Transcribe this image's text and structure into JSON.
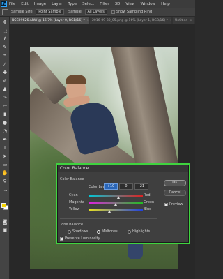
{
  "menubar": {
    "logo": "Ps",
    "items": [
      "File",
      "Edit",
      "Image",
      "Layer",
      "Type",
      "Select",
      "Filter",
      "3D",
      "View",
      "Window",
      "Help"
    ]
  },
  "options": {
    "sample_size_label": "Sample Size:",
    "sample_size_value": "Point Sample",
    "sample_label": "Sample:",
    "sample_value": "All Layers",
    "show_ring_label": "Show Sampling Ring"
  },
  "tabs": [
    {
      "label": "DSC09626.ARW @ 16.7% (Layer 0, RGB/16) *",
      "active": true
    },
    {
      "label": "2016-09-30_05.png @ 16% (Layer 1, RGB/16) *",
      "active": false
    },
    {
      "label": "Untitled",
      "active": false
    }
  ],
  "tools": [
    "move-icon",
    "marquee-icon",
    "lasso-icon",
    "quick-select-icon",
    "crop-icon",
    "eyedropper-icon",
    "healing-icon",
    "brush-icon",
    "clone-stamp-icon",
    "history-brush-icon",
    "eraser-icon",
    "gradient-icon",
    "blur-icon",
    "dodge-icon",
    "pen-icon",
    "type-icon",
    "path-select-icon",
    "rectangle-icon",
    "hand-icon",
    "zoom-icon"
  ],
  "dialog": {
    "title": "Color Balance",
    "color_balance_header": "Color Balance",
    "color_levels_label": "Color Levels:",
    "levels": [
      "+10",
      "0",
      "-21"
    ],
    "sliders": [
      {
        "left": "Cyan",
        "right": "Red",
        "gradient_from": "#00c8d8",
        "gradient_to": "#e02020",
        "position": 0.55
      },
      {
        "left": "Magenta",
        "right": "Green",
        "gradient_from": "#e020e0",
        "gradient_to": "#20c020",
        "position": 0.5
      },
      {
        "left": "Yellow",
        "right": "Blue",
        "gradient_from": "#e8e020",
        "gradient_to": "#2040e0",
        "position": 0.38
      }
    ],
    "tone_balance_header": "Tone Balance",
    "tones": [
      {
        "label": "Shadows",
        "selected": false
      },
      {
        "label": "Midtones",
        "selected": true
      },
      {
        "label": "Highlights",
        "selected": false
      }
    ],
    "preserve_luminosity": "Preserve Luminosity",
    "ok": "OK",
    "cancel": "Cancel",
    "preview": "Preview"
  },
  "colors": {
    "foreground": "#f5d400",
    "background": "#ffffff",
    "dialog_highlight": "#3fd33f",
    "selected_field": "#2a66b8"
  }
}
